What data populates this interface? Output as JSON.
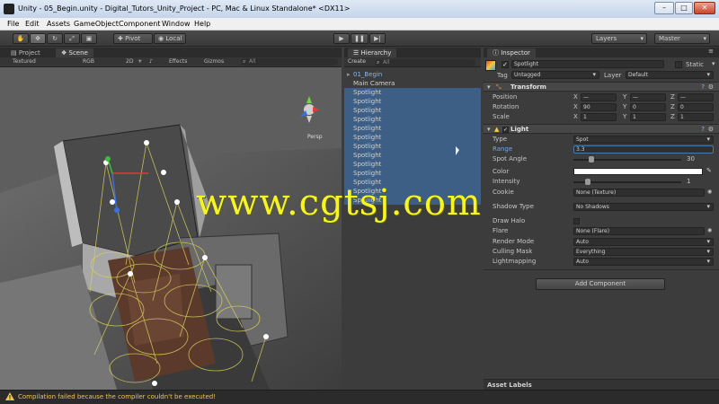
{
  "window": {
    "title": "Unity - 05_Begin.unity - Digital_Tutors_Unity_Project - PC, Mac & Linux Standalone* <DX11>",
    "minimize": "–",
    "maximize": "□",
    "close": "✕"
  },
  "menu": [
    "File",
    "Edit",
    "Assets",
    "GameObject",
    "Component",
    "Window",
    "Help"
  ],
  "toolbar": {
    "pivot": "Pivot",
    "local": "Local",
    "layers": "Layers",
    "layout": "Master"
  },
  "scene": {
    "tabs": [
      "Project",
      "Scene"
    ],
    "render_mode": "Textured",
    "color_mode": "RGB",
    "mode_2d": "2D",
    "effects": "Effects",
    "gizmos": "Gizmos",
    "search_placeholder": "All",
    "gizmo_label": "Persp"
  },
  "hierarchy": {
    "tab": "Hierarchy",
    "create": "Create",
    "search_placeholder": "All",
    "scene_name": "01_Begin",
    "items": [
      "Main Camera",
      "Spotlight",
      "Spotlight",
      "Spotlight",
      "Spotlight",
      "Spotlight",
      "Spotlight",
      "Spotlight",
      "Spotlight",
      "Spotlight",
      "Spotlight",
      "Spotlight",
      "Spotlight",
      "Spotlight"
    ]
  },
  "inspector": {
    "tab": "Inspector",
    "object_name": "Spotlight",
    "static_label": "Static",
    "tag_label": "Tag",
    "tag_value": "Untagged",
    "layer_label": "Layer",
    "layer_value": "Default",
    "transform": {
      "title": "Transform",
      "position_label": "Position",
      "rotation_label": "Rotation",
      "scale_label": "Scale",
      "position": [
        "—",
        "—",
        "—"
      ],
      "rotation": [
        "90",
        "0",
        "0"
      ],
      "scale": [
        "1",
        "1",
        "1"
      ]
    },
    "light": {
      "title": "Light",
      "type_label": "Type",
      "type_value": "Spot",
      "range_label": "Range",
      "range_value": "3.3",
      "spot_angle_label": "Spot Angle",
      "spot_angle_value": "30",
      "color_label": "Color",
      "intensity_label": "Intensity",
      "intensity_value": "1",
      "cookie_label": "Cookie",
      "cookie_value": "None (Texture)",
      "shadow_label": "Shadow Type",
      "shadow_value": "No Shadows",
      "draw_halo_label": "Draw Halo",
      "flare_label": "Flare",
      "flare_value": "None (Flare)",
      "render_mode_label": "Render Mode",
      "render_mode_value": "Auto",
      "culling_mask_label": "Culling Mask",
      "culling_mask_value": "Everything",
      "lightmapping_label": "Lightmapping",
      "lightmapping_value": "Auto"
    },
    "add_component": "Add Component",
    "asset_labels": "Asset Labels"
  },
  "status": {
    "message": "Compilation failed because the compiler couldn't be executed!"
  },
  "watermark": "www.cgtsj.com",
  "colors": {
    "watermark": "#f6f421",
    "selection": "#3d5f86",
    "status_warning": "#f0c64a"
  }
}
